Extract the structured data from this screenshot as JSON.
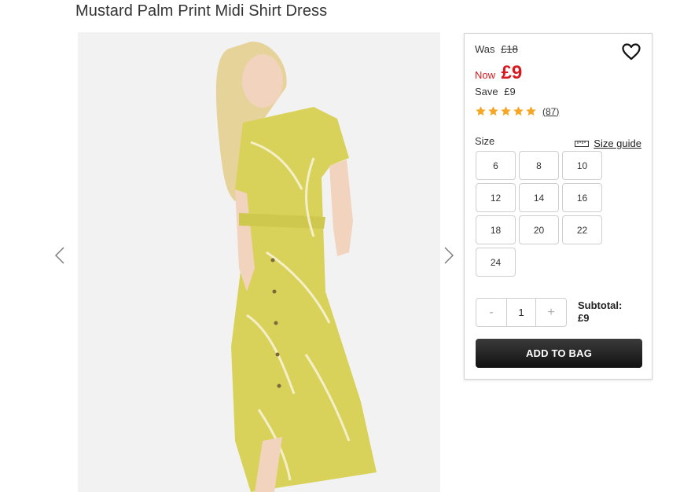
{
  "product": {
    "title": "Mustard Palm Print Midi Shirt Dress"
  },
  "gallery": {
    "prev_icon": "chevron-left-icon",
    "next_icon": "chevron-right-icon"
  },
  "pricing": {
    "was_label": "Was",
    "was_price": "£18",
    "now_label": "Now",
    "now_price": "£9",
    "save_label": "Save",
    "save_value": "£9",
    "accent_color": "#d61a20"
  },
  "rating": {
    "stars": 5,
    "review_count": "87",
    "star_color": "#f5a623"
  },
  "size": {
    "label": "Size",
    "guide_label": "Size guide",
    "options": [
      "6",
      "8",
      "10",
      "12",
      "14",
      "16",
      "18",
      "20",
      "22",
      "24"
    ]
  },
  "quantity": {
    "minus": "-",
    "value": "1",
    "plus": "+"
  },
  "subtotal": {
    "label": "Subtotal:",
    "value": "£9"
  },
  "cta": {
    "add_to_bag": "ADD TO BAG"
  }
}
